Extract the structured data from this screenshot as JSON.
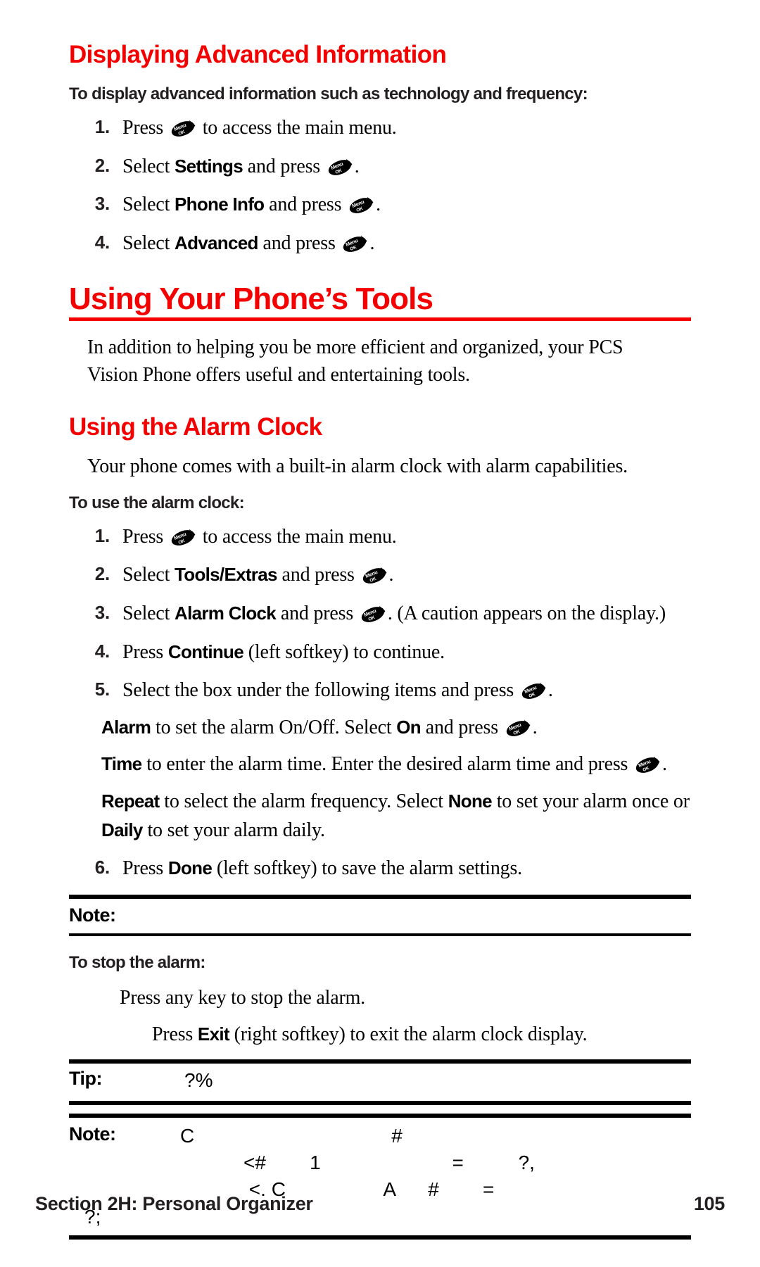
{
  "colors": {
    "heading_red": "#f40000",
    "body_text": "#000000",
    "lead_text": "#231f20"
  },
  "icon": {
    "name": "menu-ok-key-icon",
    "line1": "Menu",
    "line2": "OK"
  },
  "section_advanced": {
    "heading": "Displaying Advanced Information",
    "lead": "To display advanced information such as technology and frequency:",
    "steps": [
      {
        "num": "1.",
        "pre": "Press ",
        "post": " to access the main menu.",
        "bold": "",
        "tail": ""
      },
      {
        "num": "2.",
        "pre": "Select ",
        "bold": "Settings",
        "post": " and press ",
        "tail": "."
      },
      {
        "num": "3.",
        "pre": "Select ",
        "bold": "Phone Info",
        "post": " and press ",
        "tail": "."
      },
      {
        "num": "4.",
        "pre": "Select ",
        "bold": "Advanced",
        "post": " and press ",
        "tail": "."
      }
    ]
  },
  "section_tools": {
    "heading": "Using Your Phone’s Tools",
    "paragraph": "In addition to helping you be more efficient and organized, your PCS Vision Phone offers useful and entertaining tools."
  },
  "section_alarm": {
    "heading": "Using the Alarm Clock",
    "paragraph": "Your phone comes with a built-in alarm clock with alarm capabilities.",
    "lead": "To use the alarm clock:",
    "steps": [
      {
        "num": "1.",
        "pre": "Press ",
        "bold": "",
        "post": " to access the main menu.",
        "tail": ""
      },
      {
        "num": "2.",
        "pre": "Select ",
        "bold": "Tools/Extras",
        "post": " and press ",
        "tail": "."
      },
      {
        "num": "3.",
        "pre": "Select ",
        "bold": "Alarm Clock",
        "post": " and press ",
        "tail": ". (A caution appears on the display.)"
      },
      {
        "num": "4.",
        "pre": "Press ",
        "bold": "Continue",
        "post": " (left softkey) to continue.",
        "tail": ""
      },
      {
        "num": "5.",
        "pre": "Select the box under the following items and press ",
        "bold": "",
        "post": "",
        "tail": "."
      }
    ],
    "substeps": [
      {
        "bold1": "Alarm",
        "text1": " to set the alarm On/Off. Select ",
        "bold2": "On",
        "text2": " and press ",
        "tail": "."
      },
      {
        "bold1": "Time",
        "text1": " to enter the alarm time. Enter the desired alarm time and press ",
        "bold2": "",
        "text2": "",
        "tail": "."
      },
      {
        "bold1": "Repeat",
        "text1": " to select the alarm frequency. Select ",
        "bold2": "None",
        "text2": " to set your alarm once or ",
        "bold3": "Daily",
        "text3": " to set your alarm daily."
      }
    ],
    "step6": {
      "num": "6.",
      "pre": "Press ",
      "bold": "Done",
      "post": " (left softkey) to save the alarm settings."
    }
  },
  "note_box_1": {
    "label": "Note:",
    "body": ""
  },
  "stop_alarm": {
    "lead": "To stop the alarm:",
    "line1": "Press any key to stop the alarm.",
    "line2_pre": "Press ",
    "line2_bold": "Exit",
    "line2_post": " (right softkey) to exit the alarm clock display."
  },
  "tip_box": {
    "label": "Tip:",
    "body": "?%"
  },
  "note_box_2": {
    "label": "Note:",
    "line1": "C                                    #",
    "line2": "         <#        1                        =          ?,",
    "line3": "          <. C                  A      #        =",
    "line4": "?;"
  },
  "footer": {
    "left": "Section 2H: Personal Organizer",
    "right": "105"
  }
}
